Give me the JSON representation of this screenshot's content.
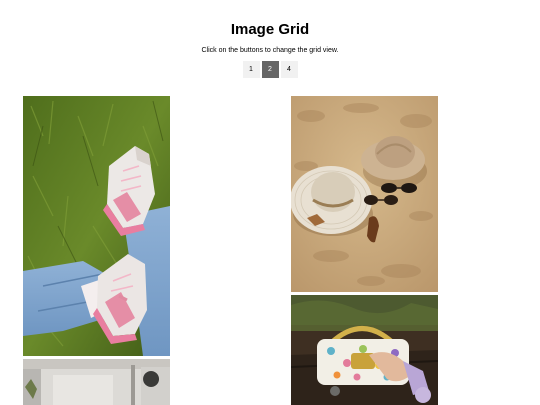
{
  "header": {
    "title": "Image Grid",
    "subtitle": "Click on the buttons to change the grid view."
  },
  "grid_buttons": {
    "items": [
      {
        "label": "1",
        "active": false
      },
      {
        "label": "2",
        "active": true
      },
      {
        "label": "4",
        "active": false
      }
    ]
  },
  "images": [
    {
      "name": "sneakers-on-grass-photo"
    },
    {
      "name": "sign-photo"
    },
    {
      "name": "sun-hats-on-sand-photo"
    },
    {
      "name": "handbag-photo"
    }
  ],
  "colors": {
    "active_button_bg": "#666666",
    "inactive_button_bg": "#f1f1f1"
  }
}
